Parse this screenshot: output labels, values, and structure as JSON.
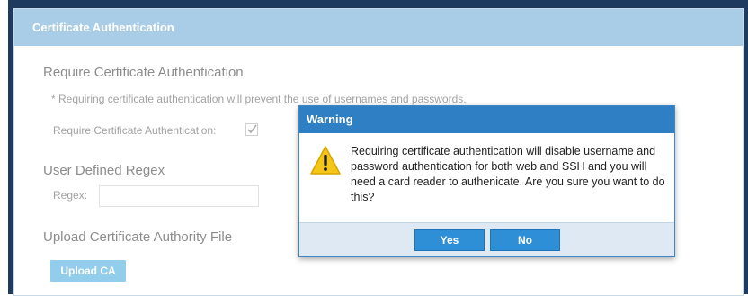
{
  "panel": {
    "header": "Certificate Authentication",
    "require_section": {
      "title": "Require Certificate Authentication",
      "note": "* Requiring certificate authentication will prevent the use of usernames and passwords.",
      "checkbox_label": "Require Certificate Authentication:",
      "checked": true
    },
    "regex_section": {
      "title": "User Defined Regex",
      "label": "Regex:",
      "value": ""
    },
    "upload_section": {
      "title": "Upload Certificate Authority File",
      "button": "Upload CA"
    }
  },
  "dialog": {
    "title": "Warning",
    "icon": "warning-triangle-icon",
    "message": "Requiring certificate authentication will disable username and password authentication for both web and SSH and you will need a card reader to authenicate. Are you sure you want to do this?",
    "yes": "Yes",
    "no": "No"
  },
  "colors": {
    "header_bg": "#a9cde6",
    "dialog_title_bg": "#2e7fc3",
    "button_bg": "#2f8fd6",
    "warning_yellow": "#f5c518"
  }
}
